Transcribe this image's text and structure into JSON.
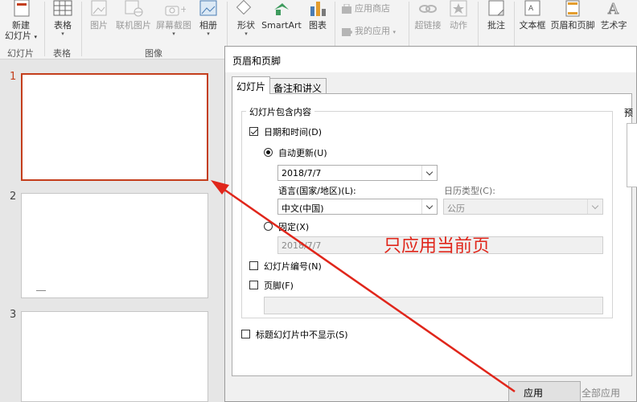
{
  "ribbon": {
    "new_slide": {
      "line1": "新建",
      "line2": "幻灯片",
      "caret": "▾"
    },
    "table": {
      "label": "表格",
      "caret": "▾"
    },
    "picture": {
      "label": "图片"
    },
    "online_picture": {
      "label": "联机图片"
    },
    "screenshot": {
      "label": "屏幕截图",
      "caret": "▾"
    },
    "album": {
      "label": "相册",
      "caret": "▾"
    },
    "shapes": {
      "label": "形状",
      "caret": "▾"
    },
    "smartart": {
      "label": "SmartArt"
    },
    "chart": {
      "label": "图表"
    },
    "store": {
      "label": "应用商店"
    },
    "my_apps": {
      "label": "我的应用",
      "caret": "▾"
    },
    "hyperlink": {
      "label": "超链接"
    },
    "action": {
      "label": "动作"
    },
    "comment": {
      "label": "批注"
    },
    "textbox": {
      "label": "文本框"
    },
    "header_footer": {
      "label": "页眉和页脚"
    },
    "wordart": {
      "label": "艺术字"
    },
    "groups": {
      "slides": "幻灯片",
      "tables": "表格",
      "images": "图像"
    }
  },
  "thumbnails": [
    {
      "number": "1",
      "active": true
    },
    {
      "number": "2",
      "active": false
    },
    {
      "number": "3",
      "active": false
    }
  ],
  "dialog": {
    "title": "页眉和页脚",
    "tabs": [
      "幻灯片",
      "备注和讲义"
    ],
    "group_label": "幻灯片包含内容",
    "date_time": {
      "label": "日期和时间(D)",
      "checked": true
    },
    "auto_update": {
      "label": "自动更新(U)",
      "selected": true
    },
    "date_value": "2018/7/7",
    "language_label": "语言(国家/地区)(L):",
    "language_value": "中文(中国)",
    "calendar_label": "日历类型(C):",
    "calendar_value": "公历",
    "fixed": {
      "label": "固定(X)",
      "selected": false
    },
    "fixed_value": "2018/7/7",
    "slide_number": {
      "label": "幻灯片编号(N)",
      "checked": false
    },
    "footer": {
      "label": "页脚(F)",
      "checked": false
    },
    "footer_value": "",
    "hide_on_title": {
      "label": "标题幻灯片中不显示(S)",
      "checked": false
    },
    "preview_label": "预",
    "apply_button": "应用",
    "apply_all_button": "全部应用"
  },
  "annotation": {
    "text": "只应用当前页",
    "color": "#e0261b"
  },
  "colors": {
    "accent": "#c43e1c",
    "arrow": "#e0261b"
  }
}
